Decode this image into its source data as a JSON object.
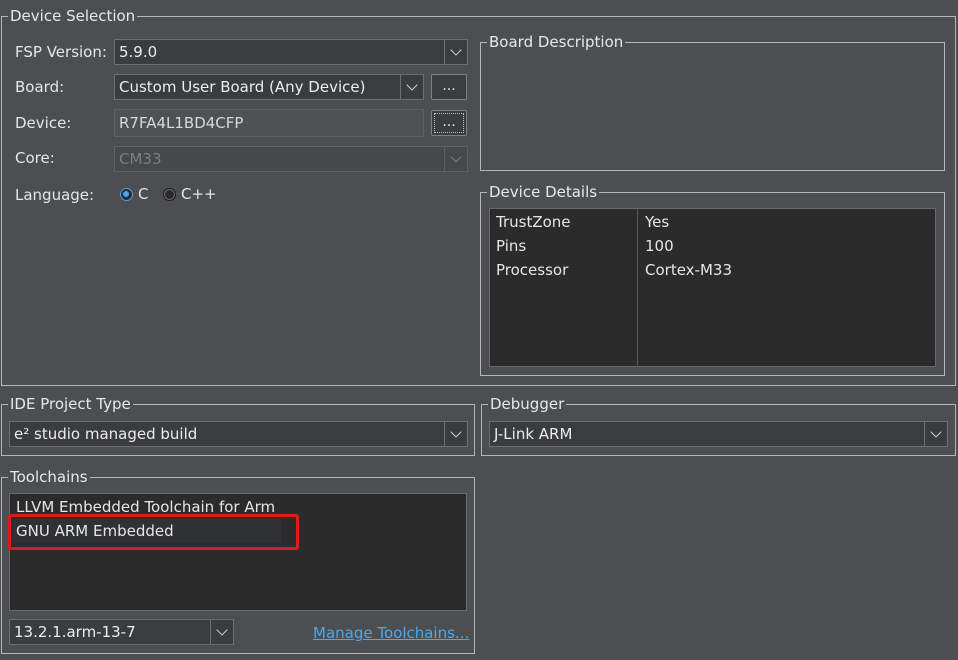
{
  "device_selection": {
    "legend": "Device Selection",
    "fsp_version": {
      "label": "FSP Version:",
      "value": "5.9.0"
    },
    "board": {
      "label": "Board:",
      "value": "Custom User Board (Any Device)",
      "button": "..."
    },
    "device": {
      "label": "Device:",
      "value": "R7FA4L1BD4CFP",
      "button": "..."
    },
    "core": {
      "label": "Core:",
      "value": "CM33"
    },
    "language": {
      "label": "Language:",
      "options": [
        {
          "label": "C",
          "selected": true
        },
        {
          "label": "C++",
          "selected": false
        }
      ]
    }
  },
  "board_description": {
    "legend": "Board Description"
  },
  "device_details": {
    "legend": "Device Details",
    "rows": [
      {
        "key": "TrustZone",
        "value": "Yes"
      },
      {
        "key": "Pins",
        "value": "100"
      },
      {
        "key": "Processor",
        "value": "Cortex-M33"
      }
    ]
  },
  "ide_project_type": {
    "legend": "IDE Project Type",
    "value": "e² studio managed build"
  },
  "debugger": {
    "legend": "Debugger",
    "value": "J-Link ARM"
  },
  "toolchains": {
    "legend": "Toolchains",
    "items": [
      {
        "label": "LLVM Embedded Toolchain for Arm"
      },
      {
        "label": "GNU ARM Embedded"
      }
    ],
    "version": "13.2.1.arm-13-7",
    "manage_link": "Manage Toolchains..."
  },
  "colors": {
    "background": "#4b4f52",
    "list_background": "#2b2b2b",
    "link": "#4fa6e8",
    "highlight": "#e0191b",
    "radio_accent": "#4aa3e8"
  }
}
